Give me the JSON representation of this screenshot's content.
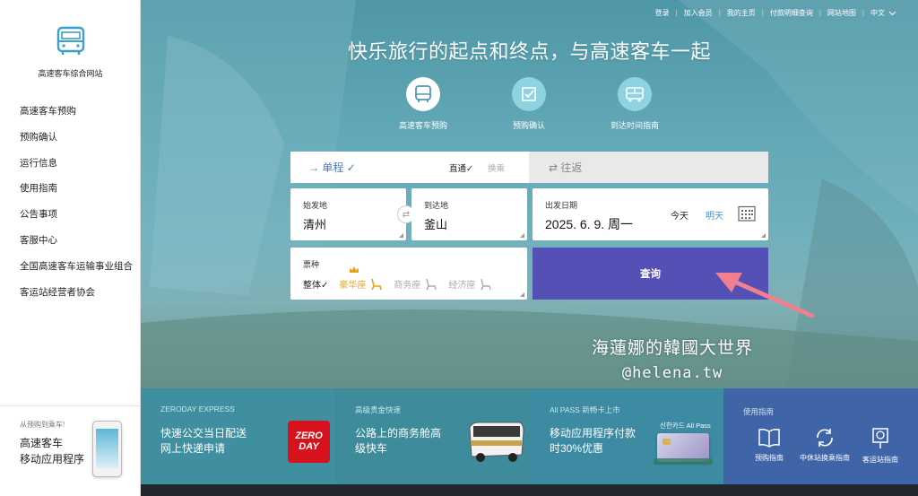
{
  "sidebar": {
    "site_name": "高速客车综合网站",
    "nav": [
      "高速客车预购",
      "预购确认",
      "运行信息",
      "使用指南",
      "公告事项",
      "客服中心",
      "全国高速客车运输事业组合",
      "客运站经营者协会"
    ],
    "promo": {
      "subtitle": "从预购到乘车!",
      "title_line1": "高速客车",
      "title_line2": "移动应用程序"
    }
  },
  "topbar": [
    "登录",
    "加入会员",
    "我的主页",
    "付款明细查询",
    "网站地图",
    "中文"
  ],
  "headline": "快乐旅行的起点和终点，与高速客车一起",
  "features": [
    {
      "label": "高速客车预购",
      "icon": "bus-icon"
    },
    {
      "label": "预购确认",
      "icon": "check-icon"
    },
    {
      "label": "到达时间指南",
      "icon": "bus-time-icon"
    }
  ],
  "search": {
    "trip_oneway": "→ 单程 ✓",
    "trip_direct": "直通✓",
    "trip_transfer": "换乘",
    "trip_round": "⇄ 往返",
    "origin_label": "始发地",
    "origin_value": "清州",
    "dest_label": "到达地",
    "dest_value": "釜山",
    "date_label": "出发日期",
    "date_value": "2025. 6. 9. 周一",
    "today": "今天",
    "tomorrow": "明天",
    "ticket_label": "票种",
    "seat_whole": "整体✓",
    "seat_premium": "豪华座",
    "seat_business": "商务座",
    "seat_economy": "经济座",
    "search_button": "查询"
  },
  "watermark": {
    "line1": "海蓮娜的韓國大世界",
    "line2": "@helena.tw"
  },
  "strip": {
    "p1": {
      "tag": "ZERODAY EXPRESS",
      "line1": "快速公交当日配送",
      "line2": "网上快递申请",
      "logo_line1": "ZERO",
      "logo_line2": "DAY"
    },
    "p2": {
      "tag": "高级贵金快速",
      "line1": "公路上的商务舱高",
      "line2": "级快车"
    },
    "p3": {
      "tag": "All PASS 新畅卡上市",
      "line1": "移动应用程序付款",
      "line2": "时30%优惠",
      "card_label": "신한카드 All Pass"
    },
    "p4": {
      "tag": "使用指南",
      "items": [
        "预购指南",
        "中休站换乘指南",
        "客运站指南"
      ]
    }
  }
}
